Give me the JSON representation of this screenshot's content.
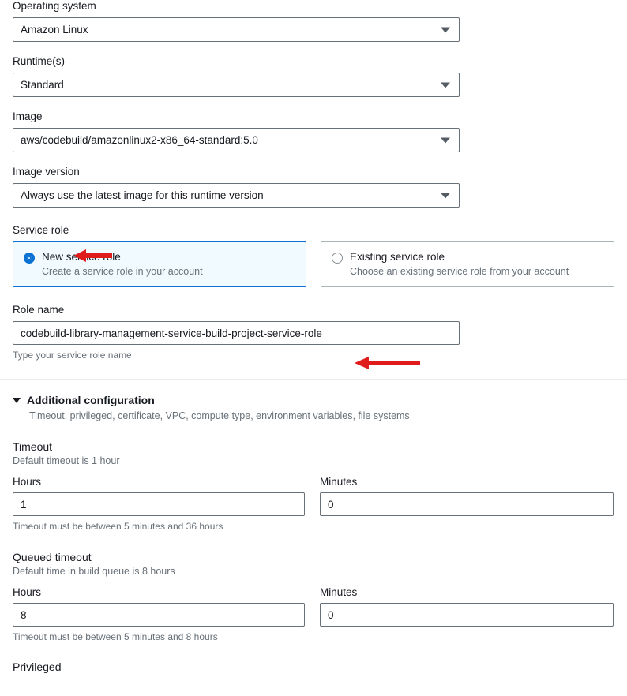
{
  "fields": {
    "operating_system": {
      "label": "Operating system",
      "value": "Amazon Linux"
    },
    "runtimes": {
      "label": "Runtime(s)",
      "value": "Standard"
    },
    "image": {
      "label": "Image",
      "value": "aws/codebuild/amazonlinux2-x86_64-standard:5.0"
    },
    "image_version": {
      "label": "Image version",
      "value": "Always use the latest image for this runtime version"
    }
  },
  "service_role": {
    "label": "Service role",
    "options": [
      {
        "title": "New service role",
        "description": "Create a service role in your account",
        "selected": true
      },
      {
        "title": "Existing service role",
        "description": "Choose an existing service role from your account",
        "selected": false
      }
    ]
  },
  "role_name": {
    "label": "Role name",
    "value": "codebuild-library-management-service-build-project-service-role",
    "hint": "Type your service role name"
  },
  "additional_configuration": {
    "title": "Additional configuration",
    "subtitle": "Timeout, privileged, certificate, VPC, compute type, environment variables, file systems"
  },
  "timeout": {
    "title": "Timeout",
    "subtitle": "Default timeout is 1 hour",
    "hours_label": "Hours",
    "hours_value": "1",
    "minutes_label": "Minutes",
    "minutes_value": "0",
    "hint": "Timeout must be between 5 minutes and 36 hours"
  },
  "queued_timeout": {
    "title": "Queued timeout",
    "subtitle": "Default time in build queue is 8 hours",
    "hours_label": "Hours",
    "hours_value": "8",
    "minutes_label": "Minutes",
    "minutes_value": "0",
    "hint": "Timeout must be between 5 minutes and 8 hours"
  },
  "privileged": {
    "label": "Privileged"
  },
  "colors": {
    "accent": "#0972d3",
    "selected_tile_bg": "#f1faff",
    "border": "#687078",
    "annotation": "#e01b1b"
  }
}
